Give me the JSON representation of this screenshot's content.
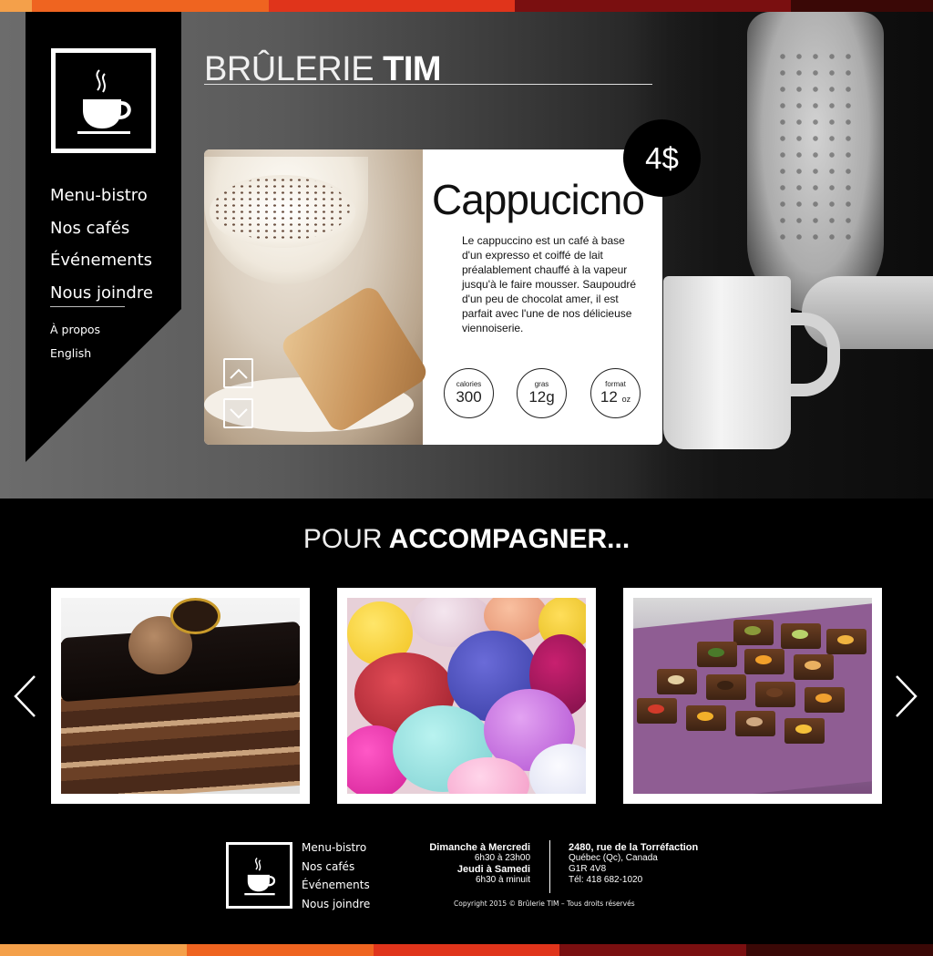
{
  "colors": {
    "stripe": [
      "#f4a04a",
      "#ef6420",
      "#e0341b",
      "#7a0f10",
      "#3a0806"
    ],
    "sidebar_bg": "#000000",
    "price_bg": "#000000"
  },
  "brand": {
    "light": "BRÛLERIE",
    "bold": "TIM"
  },
  "logo_icon": "coffee-cup-icon",
  "nav": {
    "main": [
      "Menu-bistro",
      "Nos cafés",
      "Événements",
      "Nous joindre"
    ],
    "secondary": [
      "À propos",
      "English"
    ]
  },
  "featured": {
    "title": "Cappucicno",
    "price": "4$",
    "description": "Le cappuccino est un café à base d'un expresso et coiffé de lait préalablement chauffé à la vapeur jusqu'à le faire mousser. Saupoudré d'un peu de chocolat amer, il est parfait avec l'une de nos délicieuse viennoiserie.",
    "stats": [
      {
        "label": "calories",
        "value": "300",
        "unit": ""
      },
      {
        "label": "gras",
        "value": "12g",
        "unit": ""
      },
      {
        "label": "format",
        "value": "12",
        "unit": "oz"
      }
    ],
    "up_icon": "chevron-up-icon",
    "down_icon": "chevron-down-icon"
  },
  "section": {
    "light": "POUR",
    "bold": "ACCOMPAGNER..."
  },
  "carousel": {
    "items": [
      "chocolate-cake-image",
      "macarons-image",
      "chocolate-box-image"
    ],
    "prev_icon": "chevron-left-icon",
    "next_icon": "chevron-right-icon"
  },
  "footer": {
    "nav": [
      "Menu-bistro",
      "Nos cafés",
      "Événements",
      "Nous joindre"
    ],
    "hours": [
      {
        "days": "Dimanche à Mercredi",
        "time": "6h30 à 23h00"
      },
      {
        "days": "Jeudi à Samedi",
        "time": "6h30 à minuit"
      }
    ],
    "address": {
      "street": "2480, rue de la Torréfaction",
      "city": "Québec (Qc), Canada",
      "postal": "G1R 4V8",
      "phone": "Tél: 418 682-1020"
    },
    "copyright": "Copyright 2015 © Brûlerie TIM – Tous droits réservés"
  }
}
